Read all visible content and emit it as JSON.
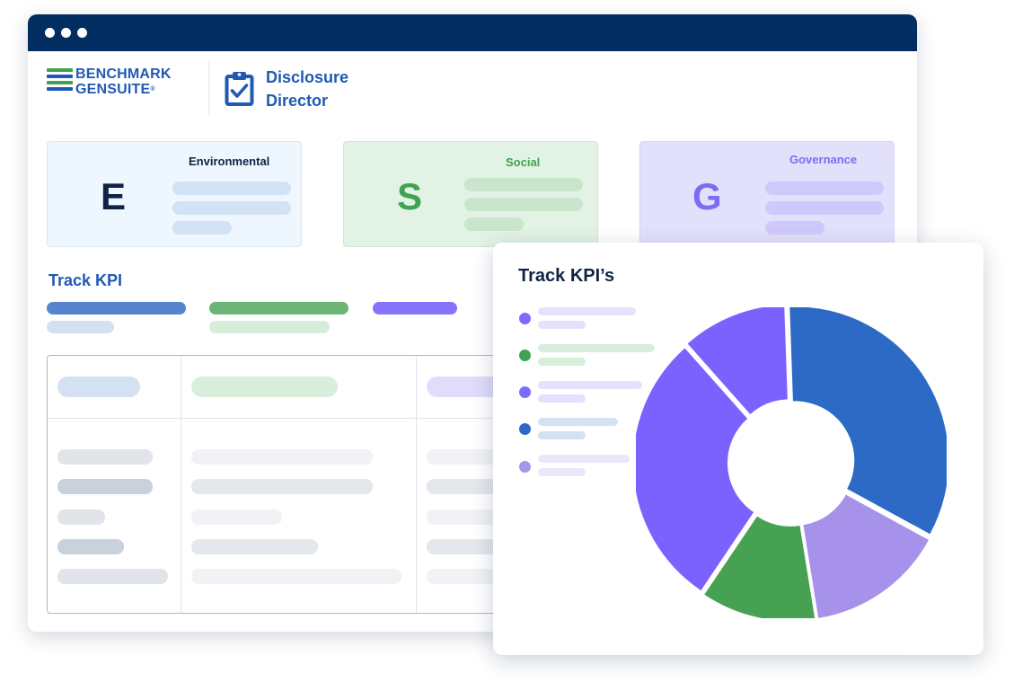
{
  "brand": {
    "logo_line1": "BENCHMARK",
    "logo_line2": "GENSUITE",
    "logo_mark": "®",
    "product_line1": "Disclosure",
    "product_line2": "Director",
    "colors": {
      "primary": "#1f5ab4",
      "titlebar": "#022d60",
      "green": "#3ea452"
    }
  },
  "window": {
    "controls": [
      "dot",
      "dot",
      "dot"
    ]
  },
  "esg_cards": [
    {
      "letter": "E",
      "label": "Environmental",
      "bg": "#eef7fd",
      "letter_color": "#0f2444",
      "label_color": "#0f2444",
      "bar_color": "#d2e1f3"
    },
    {
      "letter": "S",
      "label": "Social",
      "bg": "#e2f2e4",
      "letter_color": "#3ea452",
      "label_color": "#3ea452",
      "bar_color": "#c9e6cd"
    },
    {
      "letter": "G",
      "label": "Governance",
      "bg": "#e3e0fc",
      "letter_color": "#7c6cf2",
      "label_color": "#7c6cf2",
      "bar_color": "#cfc9fb"
    }
  ],
  "track_section": {
    "title": "Track KPI"
  },
  "overlay": {
    "title": "Track KPI’s",
    "legend_colors": [
      "#7b6cff",
      "#3ea452",
      "#7b6cff",
      "#2c6ac5",
      "#a695eb"
    ],
    "icons": [
      "clipboard-check-icon"
    ]
  },
  "chart_data": {
    "type": "pie",
    "title": "",
    "values": [
      33.5,
      14.5,
      12,
      29,
      11
    ],
    "colors": [
      "#2c6ac5",
      "#a692ea",
      "#46a252",
      "#7b62ff",
      "#7b62ff"
    ]
  }
}
